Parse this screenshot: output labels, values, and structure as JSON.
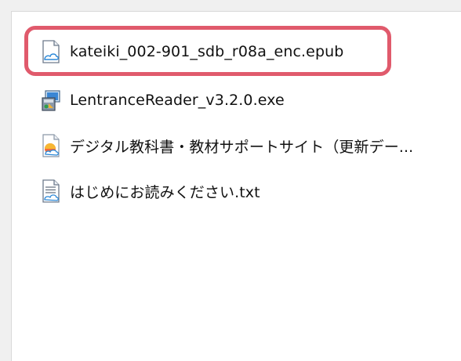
{
  "files": [
    {
      "name": "kateiki_002-901_sdb_r08a_enc.epub",
      "icon": "epub-file-icon"
    },
    {
      "name": "LentranceReader_v3.2.0.exe",
      "icon": "exe-installer-icon"
    },
    {
      "name": "デジタル教科書・教材サポートサイト（更新デー...",
      "icon": "internet-shortcut-icon"
    },
    {
      "name": "はじめにお読みください.txt",
      "icon": "text-file-icon"
    }
  ],
  "highlight": {
    "color": "#e05a6c",
    "target": "kateiki_002-901_sdb_r08a_enc.epub"
  }
}
